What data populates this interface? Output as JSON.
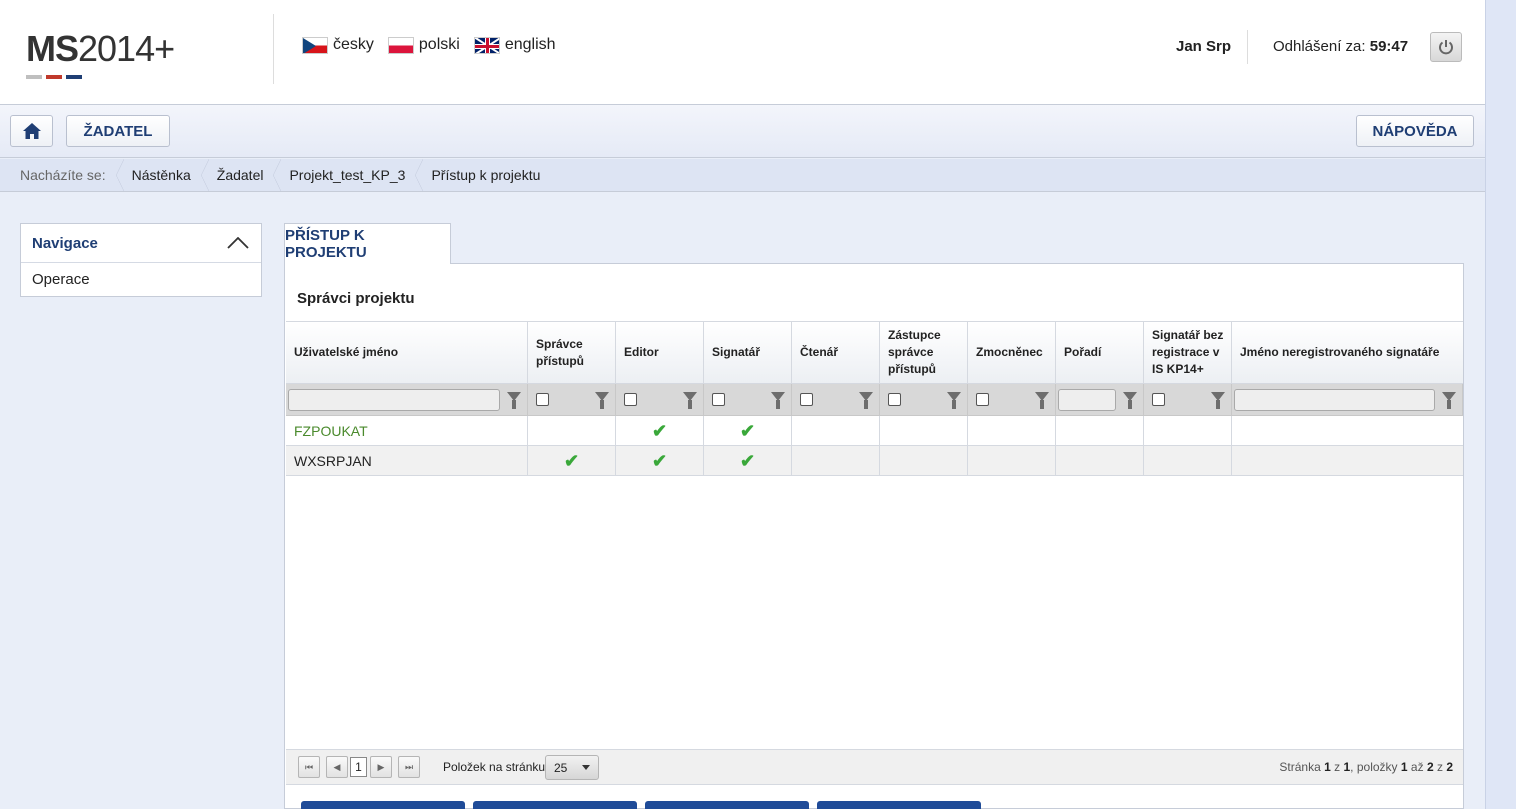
{
  "header": {
    "logo_text_bold": "MS",
    "logo_text_rest": "2014+",
    "languages": [
      {
        "code": "cz",
        "label": "česky"
      },
      {
        "code": "pl",
        "label": "polski"
      },
      {
        "code": "gb",
        "label": "english"
      }
    ],
    "user_name": "Jan Srp",
    "logout_label": "Odhlášení za:",
    "logout_timer": "59:47",
    "power_icon": "power-icon"
  },
  "toolbar": {
    "home_icon": "home-icon",
    "zadatel_label": "ŽADATEL",
    "help_label": "NÁPOVĚDA"
  },
  "breadcrumb": {
    "label": "Nacházíte se:",
    "items": [
      "Nástěnka",
      "Žadatel",
      "Projekt_test_KP_3",
      "Přístup k projektu"
    ]
  },
  "navigation": {
    "title": "Navigace",
    "items": [
      "Operace"
    ]
  },
  "main": {
    "tab_label": "PŘÍSTUP K PROJEKTU",
    "section_title": "Správci projektu",
    "columns": [
      [
        "Uživatelské jméno"
      ],
      [
        "Správce",
        "přístupů"
      ],
      [
        "Editor"
      ],
      [
        "Signatář"
      ],
      [
        "Čtenář"
      ],
      [
        "Zástupce",
        "správce",
        "přístupů"
      ],
      [
        "Zmocněnec"
      ],
      [
        "Pořadí"
      ],
      [
        "Signatář bez",
        "registrace v",
        "IS KP14+"
      ],
      [
        "Jméno neregistrovaného signatáře"
      ]
    ],
    "rows": [
      {
        "username": "FZPOUKAT",
        "spravce": false,
        "editor": true,
        "signatar": true
      },
      {
        "username": "WXSRPJAN",
        "spravce": true,
        "editor": true,
        "signatar": true
      }
    ],
    "check_glyph": "✔"
  },
  "pager": {
    "current_page": "1",
    "page_size_label": "Položek na stránku",
    "page_size": "25",
    "info_prefix": "Stránka",
    "page": "1",
    "of": "z",
    "pages": "1",
    "items_label": ", položky",
    "from": "1",
    "to_word": "až",
    "to": "2",
    "total": "2"
  },
  "colors": {
    "accent": "#1f3e74",
    "link_green": "#4a8a2c",
    "check_green": "#3aa83a"
  }
}
